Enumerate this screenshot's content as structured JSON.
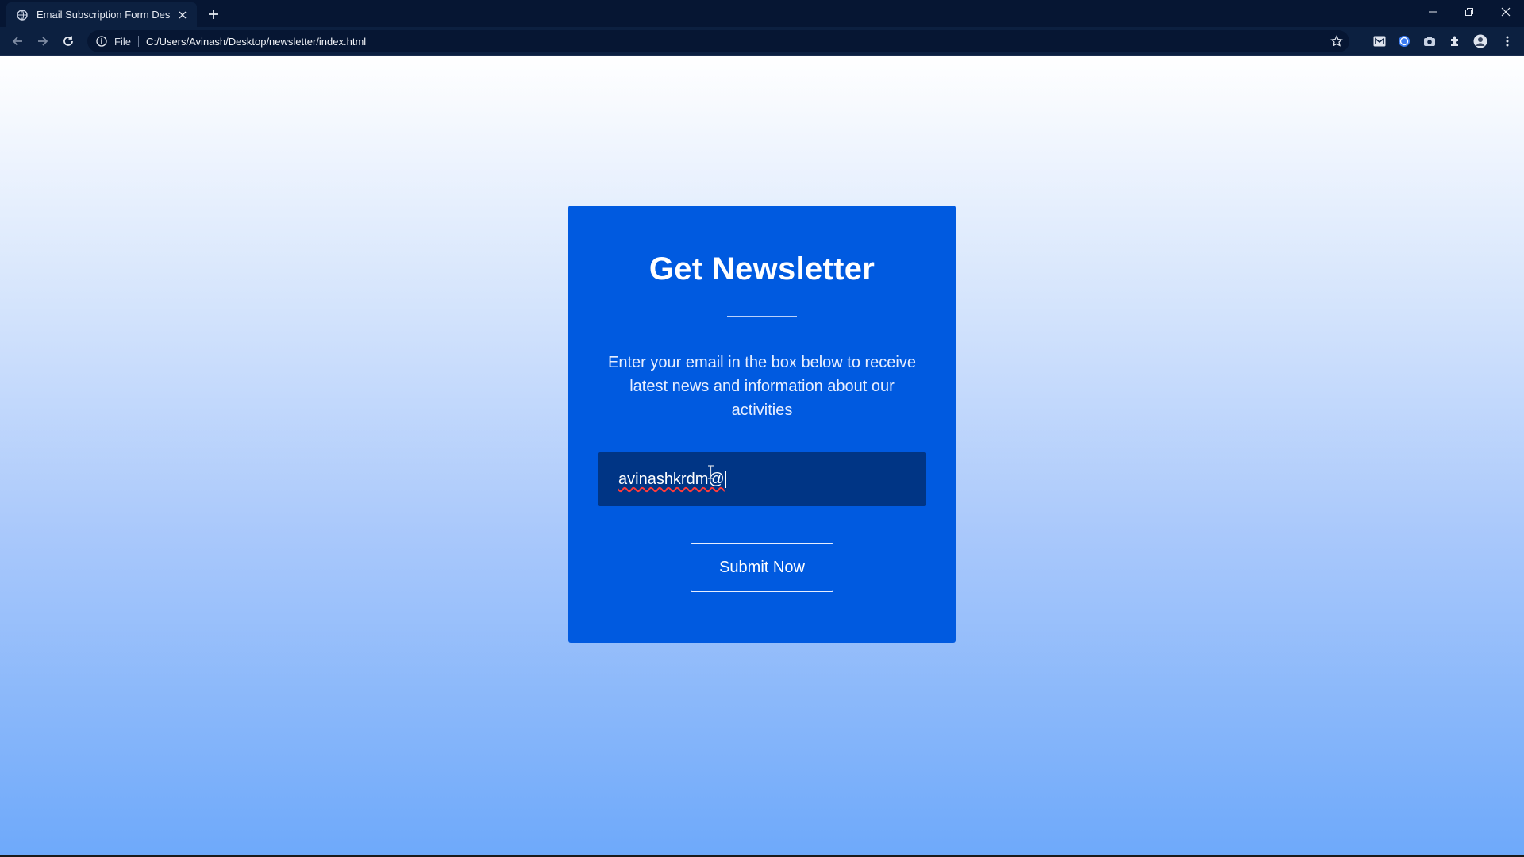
{
  "browser": {
    "tab_title": "Email Subscription Form Design",
    "address_scheme": "File",
    "address_url": "C:/Users/Avinash/Desktop/newsletter/index.html",
    "icons": [
      "globe-icon",
      "close-icon",
      "plus-icon",
      "back-arrow-icon",
      "forward-arrow-icon",
      "reload-icon",
      "info-icon",
      "star-icon",
      "gmail-extension-icon",
      "b-extension-icon",
      "camera-extension-icon",
      "puzzle-extensions-icon",
      "profile-avatar-icon",
      "kebab-menu-icon",
      "minimize-icon",
      "restore-icon",
      "window-close-icon"
    ]
  },
  "newsletter": {
    "title": "Get Newsletter",
    "description": "Enter your email in the box below to receive latest news and information about our activities",
    "email_value": "avinashkrdm@",
    "submit_label": "Submit Now"
  },
  "colors": {
    "card": "#005ae0",
    "input": "#003585",
    "chrome": "#0c2040",
    "gradient_bottom": "#6ea9fa"
  }
}
